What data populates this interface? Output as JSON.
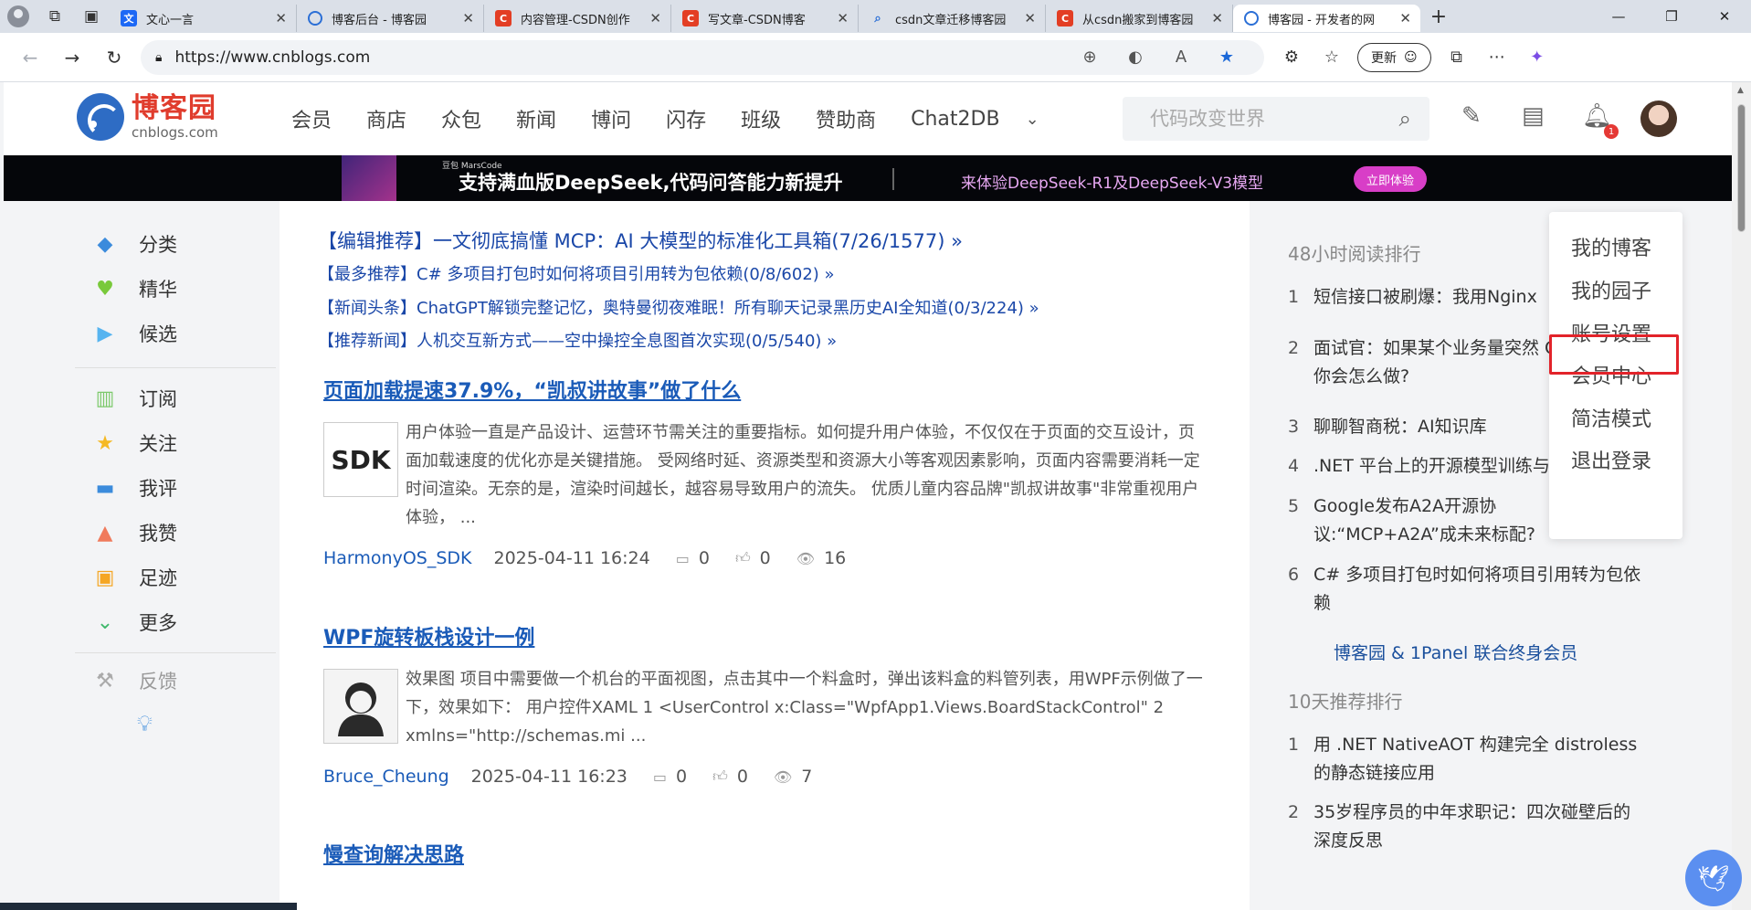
{
  "browser": {
    "tabs": [
      {
        "label": "文心一言",
        "favicon": "wenxin"
      },
      {
        "label": "博客后台 - 博客园",
        "favicon": "globe"
      },
      {
        "label": "内容管理-CSDN创作",
        "favicon": "csdn"
      },
      {
        "label": "写文章-CSDN博客",
        "favicon": "csdn"
      },
      {
        "label": "csdn文章迁移博客园",
        "favicon": "search"
      },
      {
        "label": "从csdn搬家到博客园",
        "favicon": "csdn"
      },
      {
        "label": "博客园 - 开发者的网",
        "favicon": "globe"
      }
    ],
    "active_tab": 6,
    "url": "https://www.cnblogs.com",
    "update_label": "更新"
  },
  "site": {
    "logo_cn": "博客园",
    "logo_en": "cnblogs.com",
    "nav": [
      "会员",
      "商店",
      "众包",
      "新闻",
      "博问",
      "闪存",
      "班级",
      "赞助商",
      "Chat2DB"
    ],
    "search_placeholder": "代码改变世界",
    "notification_count": "1"
  },
  "banner": {
    "small": "豆包 MarsCode",
    "headline": "支持满血版DeepSeek,代码问答能力新提升",
    "sub": "来体验DeepSeek-R1及DeepSeek-V3模型",
    "button": "立即体验"
  },
  "sidebar": {
    "group1": [
      {
        "label": "分类",
        "icon": "category-icon",
        "color": "#3b8bdc"
      },
      {
        "label": "精华",
        "icon": "heart-icon",
        "color": "#79c93b"
      },
      {
        "label": "候选",
        "icon": "play-icon",
        "color": "#56b4f0"
      }
    ],
    "group2": [
      {
        "label": "订阅",
        "icon": "books-icon",
        "color": "#7cc96b"
      },
      {
        "label": "关注",
        "icon": "star-icon",
        "color": "#f5b924"
      },
      {
        "label": "我评",
        "icon": "comment-icon",
        "color": "#3b8bdc"
      },
      {
        "label": "我赞",
        "icon": "thumb-icon",
        "color": "#f07a5c"
      },
      {
        "label": "足迹",
        "icon": "history-icon",
        "color": "#f5a623"
      },
      {
        "label": "更多",
        "icon": "chevron-icon",
        "color": "#3fb86b"
      }
    ],
    "feedback": "反馈"
  },
  "recommendations": [
    "【编辑推荐】一文彻底搞懂 MCP：AI 大模型的标准化工具箱(7/26/1577) »",
    "【最多推荐】C# 多项目打包时如何将项目引用转为包依赖(0/8/602) »",
    "【新闻头条】ChatGPT解锁完整记忆，奥特曼彻夜难眠！所有聊天记录黑历史AI全知道(0/3/224) »",
    "【推荐新闻】人机交互新方式——空中操控全息图首次实现(0/5/540) »"
  ],
  "posts": [
    {
      "title": "页面加载提速37.9%，“凯叔讲故事”做了什么",
      "thumb": "SDK",
      "summary": "用户体验一直是产品设计、运营环节需关注的重要指标。如何提升用户体验，不仅仅在于页面的交互设计，页面加载速度的优化亦是关键措施。 受网络时延、资源类型和资源大小等客观因素影响，页面内容需要消耗一定时间渲染。无奈的是，渲染时间越长，越容易导致用户的流失。 优质儿童内容品牌\"凯叔讲故事\"非常重视用户体验， ...",
      "author": "HarmonyOS_SDK",
      "date": "2025-04-11 16:24",
      "comments": "0",
      "likes": "0",
      "views": "16"
    },
    {
      "title": "WPF旋转板栈设计一例",
      "thumb": "",
      "summary": "效果图 项目中需要做一个机台的平面视图，点击其中一个料盒时，弹出该料盒的料管列表，用WPF示例做了一下，效果如下： 用户控件XAML 1 <UserControl x:Class=\"WpfApp1.Views.BoardStackControl\" 2 xmlns=\"http://schemas.mi ...",
      "author": "Bruce_Cheung",
      "date": "2025-04-11 16:23",
      "comments": "0",
      "likes": "0",
      "views": "7"
    },
    {
      "title": "慢查询解决思路"
    }
  ],
  "right": {
    "hot_title": "48小时阅读排行",
    "hot": [
      {
        "n": "1",
        "t": "短信接口被刷爆：我用Nginx"
      },
      {
        "n": "2",
        "t": "面试官：如果某个业务量突然 QPS你会怎么做?"
      },
      {
        "n": "3",
        "t": "聊聊智商税：AI知识库"
      },
      {
        "n": "4",
        "t": ".NET 平台上的开源模型训练与推理进展"
      },
      {
        "n": "5",
        "t": "Google发布A2A开源协议:“MCP+A2A”成未来标配?"
      },
      {
        "n": "6",
        "t": "C# 多项目打包时如何将项目引用转为包依赖"
      }
    ],
    "promo": "博客园 & 1Panel 联合终身会员",
    "rec_title": "10天推荐排行",
    "rec": [
      {
        "n": "1",
        "t": "用 .NET NativeAOT 构建完全 distroless 的静态链接应用"
      },
      {
        "n": "2",
        "t": "35岁程序员的中年求职记：四次碰壁后的深度反思"
      }
    ]
  },
  "dropdown": [
    "我的博客",
    "我的园子",
    "账号设置",
    "会员中心",
    "简洁模式",
    "退出登录"
  ],
  "highlighted_menu_item": "账号设置"
}
